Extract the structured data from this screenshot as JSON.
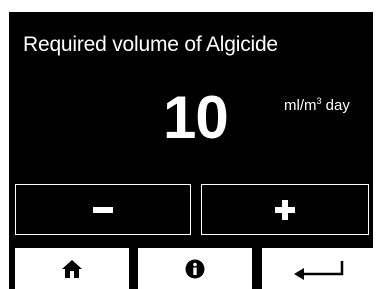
{
  "screen": {
    "title": "Required volume of Algicide",
    "value": "10",
    "unit_prefix": "ml/m",
    "unit_sup": "3",
    "unit_suffix": " day"
  },
  "controls": {
    "decrement_icon": "minus-icon",
    "increment_icon": "plus-icon"
  },
  "navbar": {
    "items": [
      {
        "icon": "home-icon"
      },
      {
        "icon": "info-icon"
      },
      {
        "icon": "back-arrow-icon"
      }
    ]
  },
  "colors": {
    "background": "#000000",
    "foreground": "#ffffff"
  }
}
